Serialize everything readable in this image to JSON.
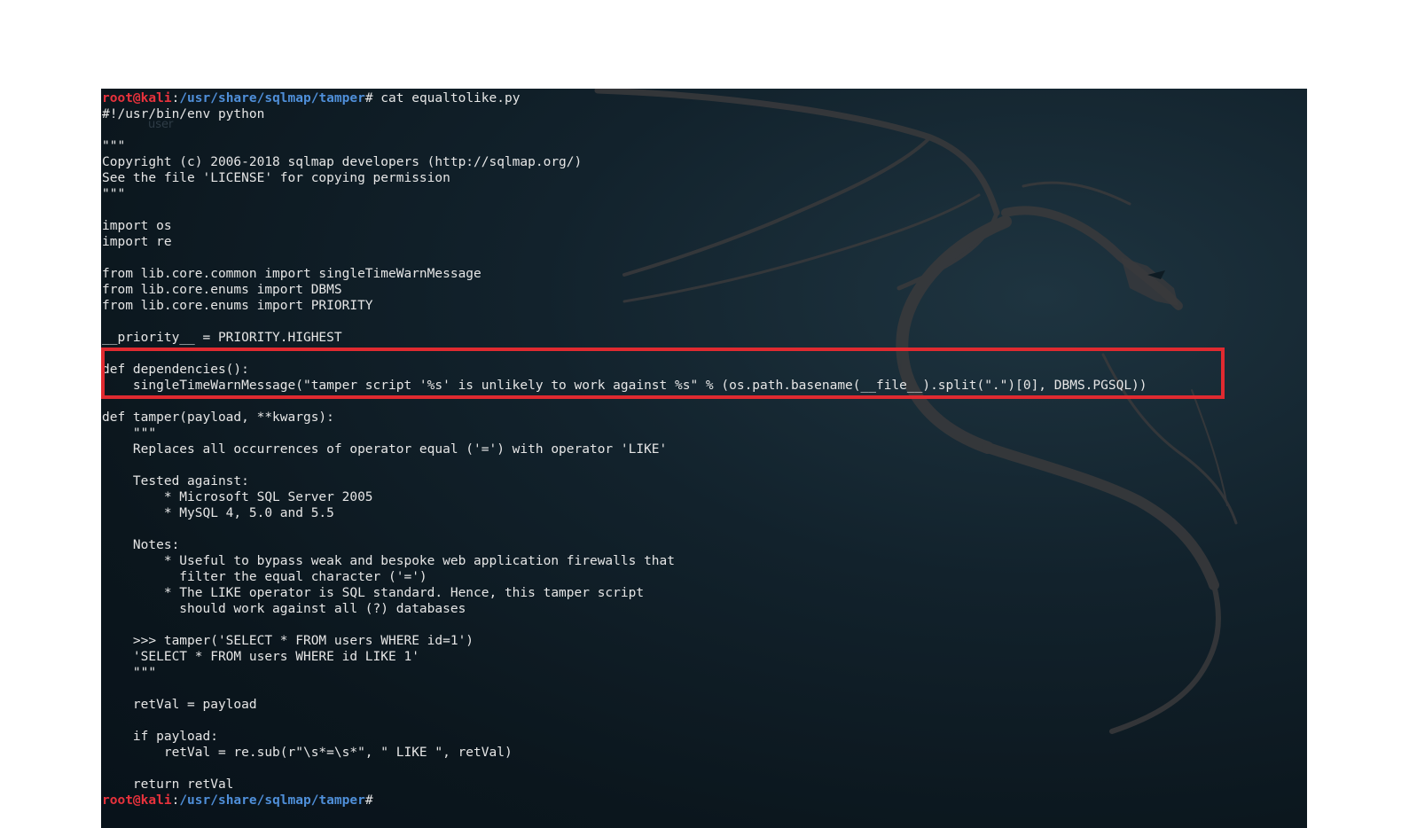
{
  "terminal": {
    "prompt": {
      "user_host": "root@kali",
      "separator": ":",
      "path": "/usr/share/sqlmap/tamper",
      "symbol": "#",
      "command": " cat equaltolike.py"
    },
    "ghost_label": "user",
    "lines": [
      "#!/usr/bin/env python",
      "",
      "\"\"\"",
      "Copyright (c) 2006-2018 sqlmap developers (http://sqlmap.org/)",
      "See the file 'LICENSE' for copying permission",
      "\"\"\"",
      "",
      "import os",
      "import re",
      "",
      "from lib.core.common import singleTimeWarnMessage",
      "from lib.core.enums import DBMS",
      "from lib.core.enums import PRIORITY",
      "",
      "__priority__ = PRIORITY.HIGHEST",
      "",
      "def dependencies():",
      "    singleTimeWarnMessage(\"tamper script '%s' is unlikely to work against %s\" % (os.path.basename(__file__).split(\".\")[0], DBMS.PGSQL))",
      "",
      "def tamper(payload, **kwargs):",
      "    \"\"\"",
      "    Replaces all occurrences of operator equal ('=') with operator 'LIKE'",
      "",
      "    Tested against:",
      "        * Microsoft SQL Server 2005",
      "        * MySQL 4, 5.0 and 5.5",
      "",
      "    Notes:",
      "        * Useful to bypass weak and bespoke web application firewalls that",
      "          filter the equal character ('=')",
      "        * The LIKE operator is SQL standard. Hence, this tamper script",
      "          should work against all (?) databases",
      "",
      "    >>> tamper('SELECT * FROM users WHERE id=1')",
      "    'SELECT * FROM users WHERE id LIKE 1'",
      "    \"\"\"",
      "",
      "    retVal = payload",
      "",
      "    if payload:",
      "        retVal = re.sub(r\"\\s*=\\s*\", \" LIKE \", retVal)",
      "",
      "    return retVal"
    ],
    "highlight_color": "#e02a30",
    "prompt_user_color": "#e8323c",
    "prompt_path_color": "#4f8fd9",
    "background_logo": "kali-dragon-icon"
  }
}
